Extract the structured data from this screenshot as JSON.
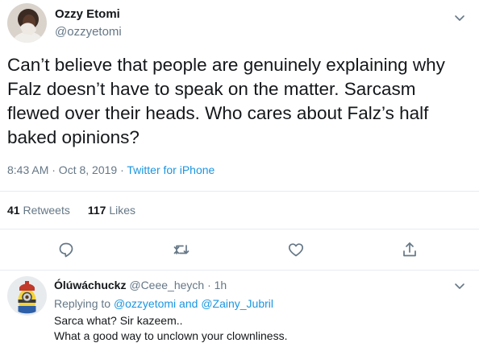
{
  "tweet": {
    "author_name": "Ozzy Etomi",
    "author_handle": "@ozzyetomi",
    "text": "Can’t believe that people are genuinely explaining why Falz doesn’t have to speak on the matter. Sarcasm flewed over their heads. Who cares about Falz’s half baked opinions?",
    "timestamp": "8:43 AM · Oct 8, 2019 · ",
    "source": "Twitter for iPhone",
    "retweets_count": "41",
    "retweets_label": "Retweets",
    "likes_count": "117",
    "likes_label": "Likes"
  },
  "actions": {
    "reply_icon": "speech-bubble-icon",
    "retweet_icon": "retweet-arrows-icon",
    "like_icon": "heart-icon",
    "share_icon": "share-upload-icon"
  },
  "reply": {
    "author_name": "Ólúwáchuckz",
    "author_handle": "@Ceee_heych",
    "separator": " · ",
    "time_ago": "1h",
    "replying_prefix": "Replying to ",
    "mention_1": "@ozzyetomi",
    "and_text": " and ",
    "mention_2": "@Zainy_Jubril",
    "line_1": "Sarca what? Sir kazeem..",
    "line_2": "What a good way to unclown your clownliness."
  },
  "colors": {
    "link": "#1b95e0",
    "secondary_text": "#657786",
    "primary_text": "#14171a",
    "divider": "#e6ecf0"
  }
}
